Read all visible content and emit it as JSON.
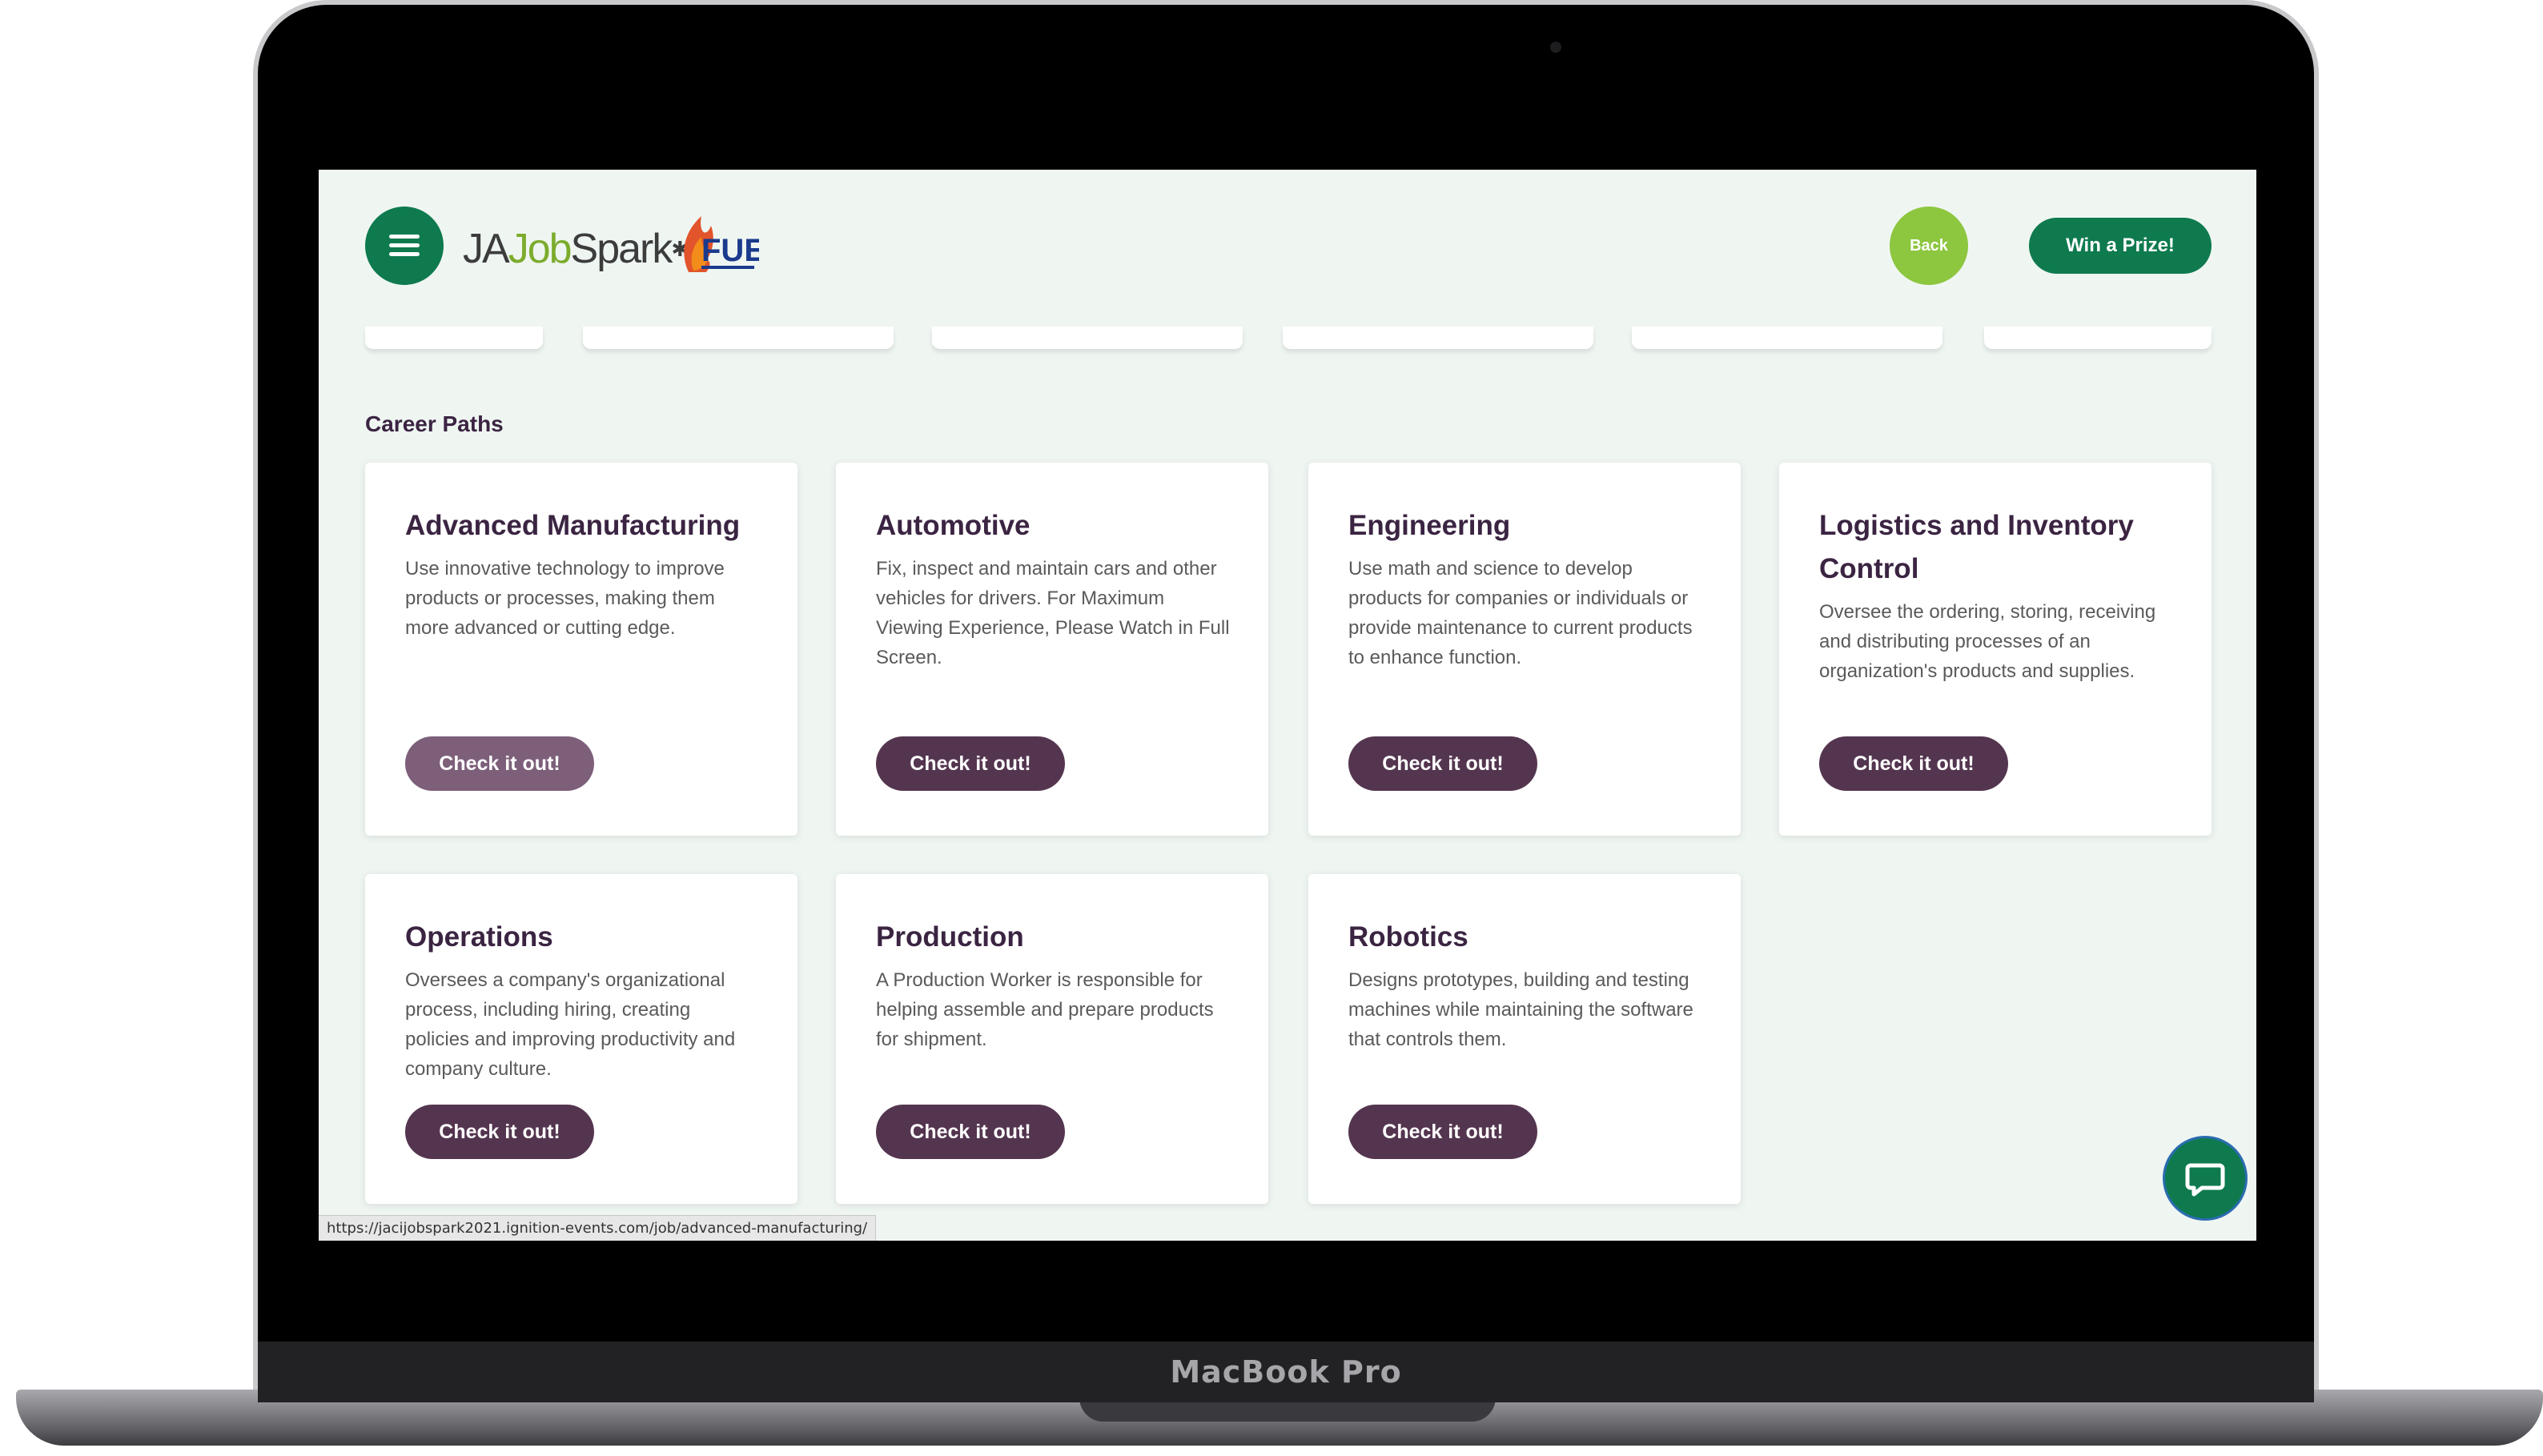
{
  "device": {
    "label": "MacBook Pro"
  },
  "header": {
    "logo": {
      "ja": "JA",
      "job": "Job",
      "spark": "Spark",
      "mark": "✱",
      "partner": "FUEL"
    },
    "back_label": "Back",
    "prize_label": "Win a Prize!"
  },
  "section": {
    "title": "Career Paths"
  },
  "cards": [
    {
      "title": "Advanced Manufacturing",
      "description": "Use innovative technology to improve products or processes, making them more advanced or cutting edge.",
      "button": "Check it out!"
    },
    {
      "title": "Automotive",
      "description": "Fix, inspect and maintain cars and other vehicles for drivers. For Maximum Viewing Experience, Please Watch in Full Screen.",
      "button": "Check it out!"
    },
    {
      "title": "Engineering",
      "description": "Use math and science to develop products for companies or individuals or provide maintenance to current products to enhance function.",
      "button": "Check it out!"
    },
    {
      "title": "Logistics and Inventory Control",
      "description": "Oversee the ordering, storing, receiving and distributing processes of an organization's products and supplies.",
      "button": "Check it out!"
    },
    {
      "title": "Operations",
      "description": "Oversees a company's organizational process, including hiring, creating policies and improving productivity and company culture.",
      "button": "Check it out!"
    },
    {
      "title": "Production",
      "description": "A Production Worker is responsible for helping assemble and prepare products for shipment.",
      "button": "Check it out!"
    },
    {
      "title": "Robotics",
      "description": "Designs prototypes, building and testing machines while maintaining the software that controls them.",
      "button": "Check it out!"
    }
  ],
  "status_bar": {
    "url": "https://jacijobspark2021.ignition-events.com/job/advanced-manufacturing/"
  },
  "colors": {
    "brand_green": "#0e7a4e",
    "accent_green": "#8dc63f",
    "button_purple": "#54354f",
    "heading_purple": "#3b2442",
    "page_bg": "#eff6f2"
  },
  "icons": {
    "menu": "hamburger-icon",
    "chat": "chat-bubble-icon",
    "fuel": "flame-icon"
  }
}
